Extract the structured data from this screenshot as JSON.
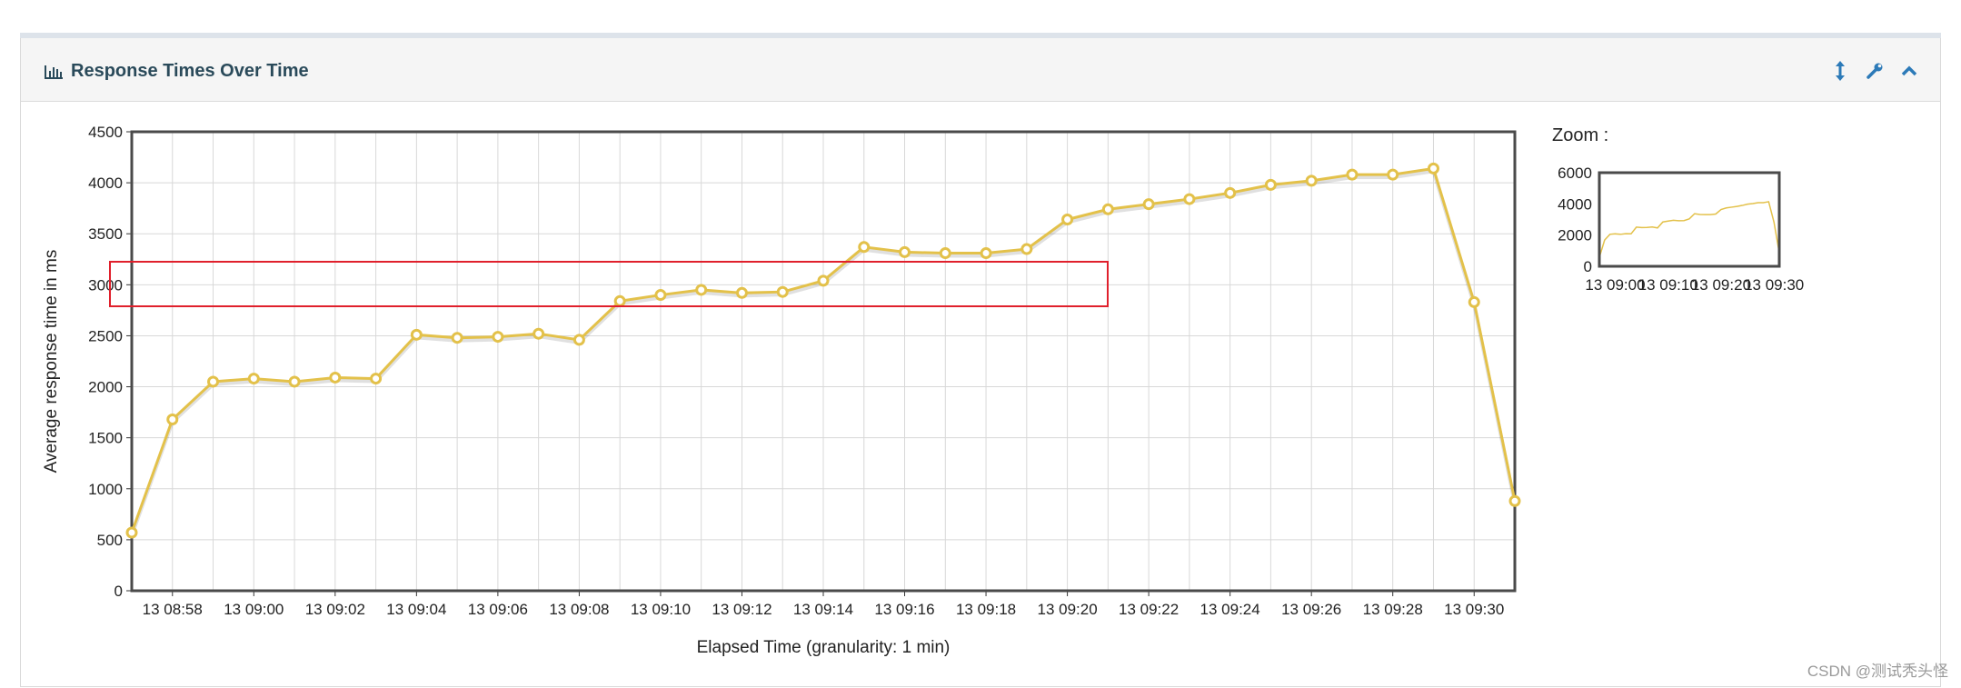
{
  "panel": {
    "title": "Response Times Over Time"
  },
  "tools": {
    "resize": "resize-icon",
    "settings": "wrench-icon",
    "collapse": "chevron-up-icon"
  },
  "zoom_label": "Zoom :",
  "watermark": "CSDN @测试秃头怪",
  "colors": {
    "series": "#e3c14a",
    "grid": "#d8d8d8",
    "annotation": "#e0202c"
  },
  "chart_data": {
    "type": "line",
    "xlabel": "Elapsed Time (granularity: 1 min)",
    "ylabel": "Average response time in ms",
    "ylim": [
      0,
      4500
    ],
    "yticks": [
      "0",
      "500",
      "1000",
      "1500",
      "2000",
      "2500",
      "3000",
      "3500",
      "4000",
      "4500"
    ],
    "x_tick_labels": [
      "13 08:58",
      "13 09:00",
      "13 09:02",
      "13 09:04",
      "13 09:06",
      "13 09:08",
      "13 09:10",
      "13 09:12",
      "13 09:14",
      "13 09:16",
      "13 09:18",
      "13 09:20",
      "13 09:22",
      "13 09:24",
      "13 09:26",
      "13 09:28",
      "13 09:30"
    ],
    "x": [
      "08:57",
      "08:58",
      "08:59",
      "09:00",
      "09:01",
      "09:02",
      "09:03",
      "09:04",
      "09:05",
      "09:06",
      "09:07",
      "09:08",
      "09:09",
      "09:10",
      "09:11",
      "09:12",
      "09:13",
      "09:14",
      "09:15",
      "09:16",
      "09:17",
      "09:18",
      "09:19",
      "09:20",
      "09:21",
      "09:22",
      "09:23",
      "09:24",
      "09:25",
      "09:26",
      "09:27",
      "09:28",
      "09:29",
      "09:30",
      "09:31"
    ],
    "values": [
      570,
      1680,
      2050,
      2080,
      2050,
      2090,
      2080,
      2510,
      2480,
      2490,
      2520,
      2460,
      2840,
      2900,
      2950,
      2920,
      2930,
      3040,
      3370,
      3320,
      3310,
      3310,
      3350,
      3640,
      3740,
      3790,
      3840,
      3900,
      3980,
      4020,
      4080,
      4080,
      4140,
      2830,
      880
    ],
    "zoom": {
      "ylim": [
        0,
        6000
      ],
      "yticks": [
        "0",
        "2000",
        "4000",
        "6000"
      ],
      "x_tick_labels": [
        "13 09:00",
        "13 09:10",
        "13 09:20",
        "13 09:30"
      ]
    }
  }
}
